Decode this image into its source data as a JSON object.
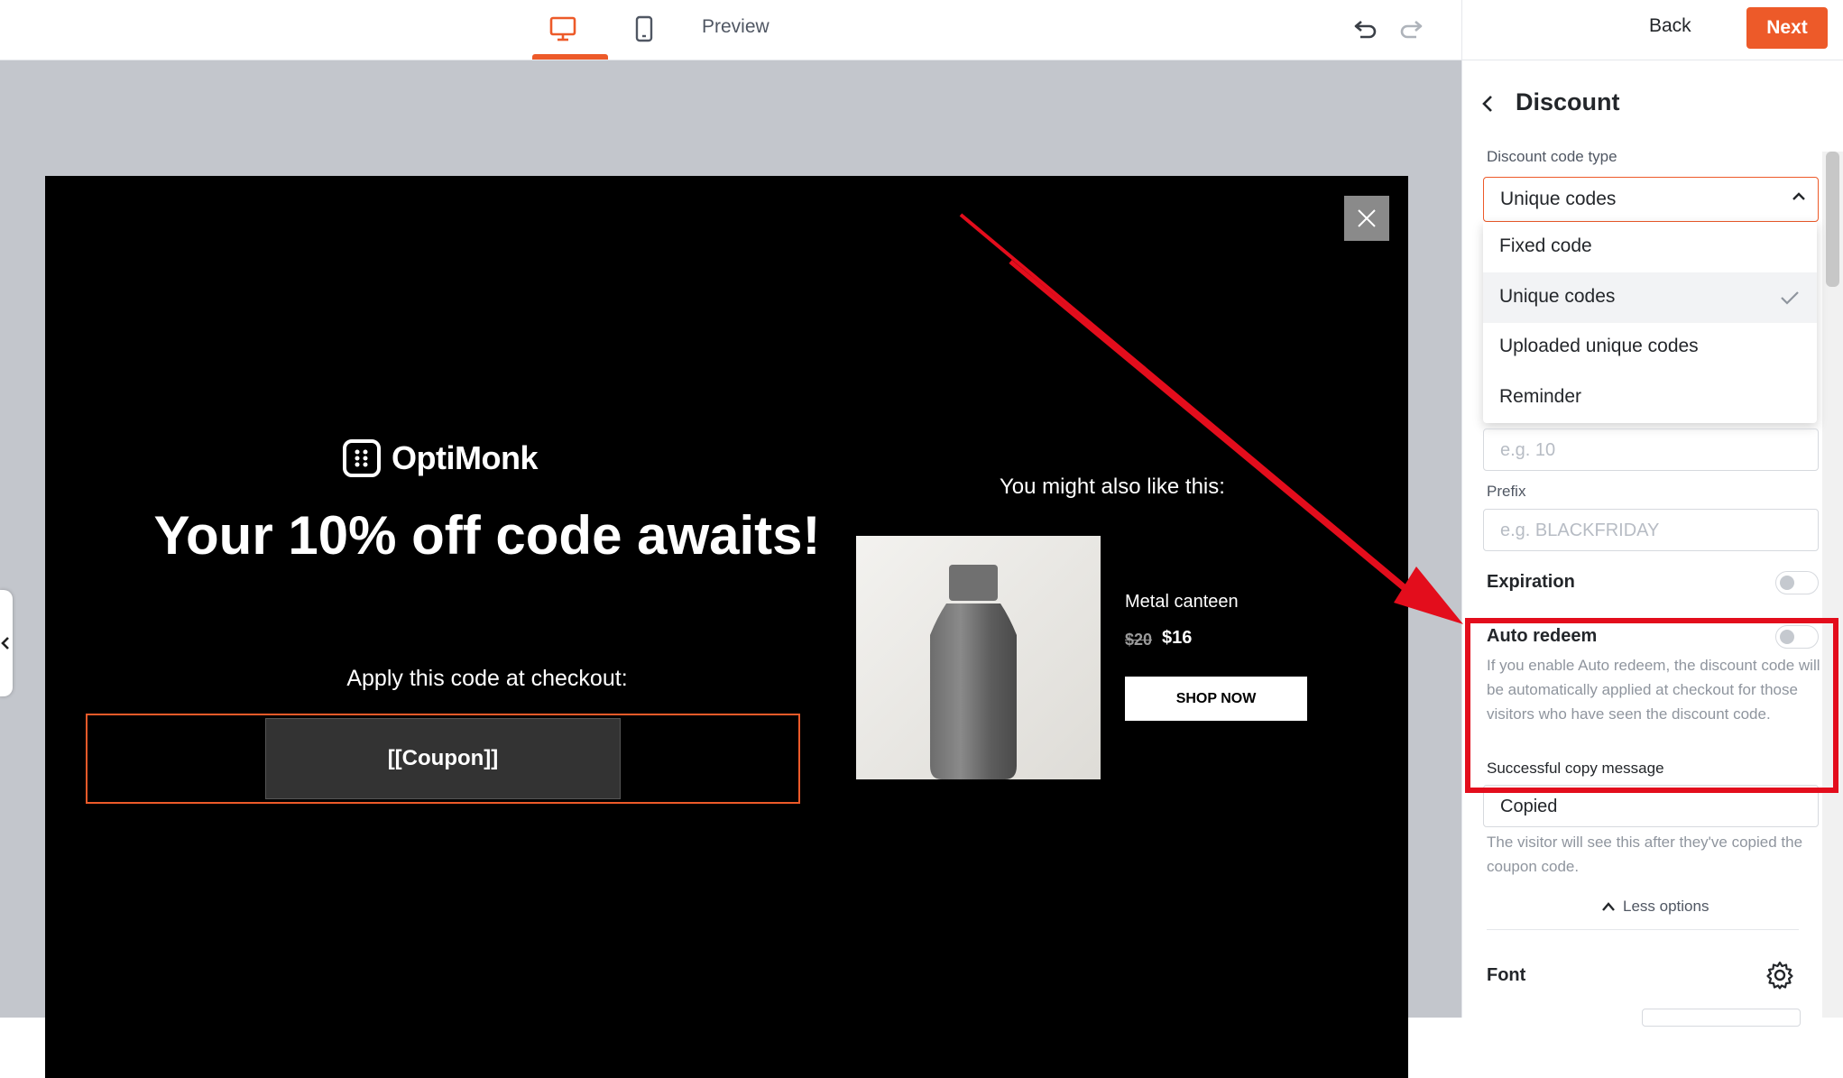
{
  "topbar": {
    "desktop_icon": "desktop-icon",
    "mobile_icon": "mobile-icon",
    "preview_label": "Preview",
    "undo_icon": "undo-icon",
    "redo_icon": "redo-icon",
    "back_label": "Back",
    "next_label": "Next"
  },
  "popup": {
    "logo_text": "OptiMonk",
    "headline": "Your 10% off code awaits!",
    "apply_text": "Apply this code at checkout:",
    "coupon_text": "[[Coupon]]",
    "recommendation_title": "You might also like this:",
    "product": {
      "name": "Metal canteen",
      "old_price": "$20",
      "new_price": "$16",
      "button": "SHOP NOW"
    }
  },
  "panel": {
    "title": "Discount",
    "code_type_label": "Discount code type",
    "code_type_value": "Unique codes",
    "dropdown_options": [
      {
        "label": "Fixed code",
        "selected": false
      },
      {
        "label": "Unique codes",
        "selected": true
      },
      {
        "label": "Uploaded unique codes",
        "selected": false
      },
      {
        "label": "Reminder",
        "selected": false
      }
    ],
    "value_placeholder": "e.g. 10",
    "prefix_label": "Prefix",
    "prefix_placeholder": "e.g. BLACKFRIDAY",
    "expiration_label": "Expiration",
    "expiration_on": false,
    "auto_redeem_label": "Auto redeem",
    "auto_redeem_on": false,
    "auto_redeem_help": "If you enable Auto redeem, the discount code will be automatically applied at checkout for those visitors who have seen the discount code.",
    "copy_message_label": "Successful copy message",
    "copy_message_value": "Copied",
    "copy_message_help": "The visitor will see this after they've copied the coupon code.",
    "less_options_label": "Less options",
    "font_label": "Font"
  },
  "colors": {
    "accent": "#ed5a29",
    "annotation_red": "#e30d1c",
    "popup_bg": "#000000",
    "canvas_bg": "#c3c6cc"
  }
}
